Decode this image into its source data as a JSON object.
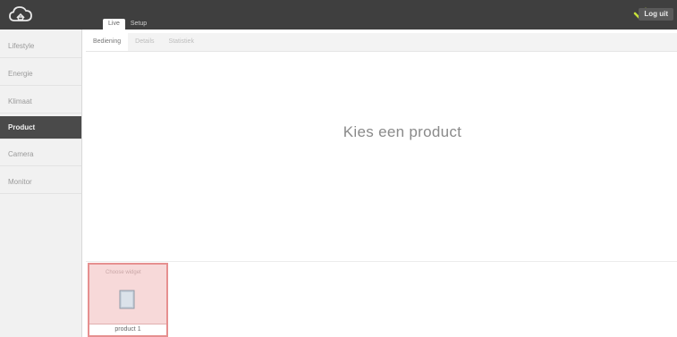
{
  "header": {
    "tabs": [
      {
        "label": "Live"
      },
      {
        "label": "Setup"
      }
    ],
    "logout_label": "Log uit",
    "colors": {
      "bar": "#3f3f3f",
      "check": "#c6e03a"
    }
  },
  "sidebar": {
    "items": [
      {
        "label": "Lifestyle"
      },
      {
        "label": "Energie"
      },
      {
        "label": "Klimaat"
      },
      {
        "label": "Product"
      },
      {
        "label": "Camera"
      },
      {
        "label": "Monitor"
      }
    ],
    "active_index": 3
  },
  "subtabs": [
    {
      "label": "Bediening"
    },
    {
      "label": "Details"
    },
    {
      "label": "Statistiek"
    }
  ],
  "main": {
    "title": "Kies een product"
  },
  "tray": {
    "card": {
      "hint": "Choose widget",
      "label": "product 1",
      "icon": "document-icon"
    }
  }
}
